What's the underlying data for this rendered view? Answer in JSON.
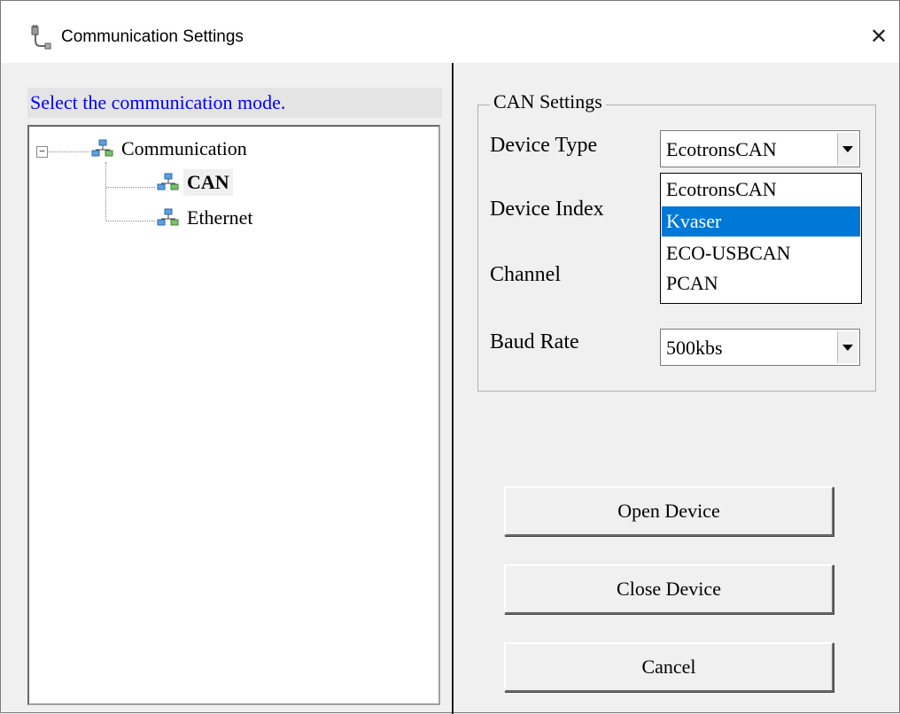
{
  "window": {
    "title": "Communication Settings",
    "close_glyph": "✕",
    "title_icon": "plug-cable-icon"
  },
  "left_panel": {
    "header": "Select the communication mode.",
    "tree": {
      "root": {
        "label": "Communication",
        "expanded": true,
        "expander_glyph": "−",
        "icon": "network-icon"
      },
      "children": [
        {
          "label": "CAN",
          "selected": true,
          "icon": "network-icon"
        },
        {
          "label": "Ethernet",
          "selected": false,
          "icon": "network-icon"
        }
      ]
    }
  },
  "can_settings": {
    "group_title": "CAN Settings",
    "device_type": {
      "label": "Device Type",
      "value": "EcotronsCAN"
    },
    "device_index": {
      "label": "Device Index"
    },
    "channel": {
      "label": "Channel"
    },
    "baud_rate": {
      "label": "Baud Rate",
      "value": "500kbs"
    },
    "device_type_options": [
      "EcotronsCAN",
      "Kvaser",
      "ECO-USBCAN",
      "PCAN"
    ],
    "highlighted_option": "Kvaser"
  },
  "buttons": {
    "open": "Open Device",
    "close": "Close Device",
    "cancel": "Cancel"
  },
  "colors": {
    "header_text": "#0000ff",
    "highlight": "#0078d7"
  }
}
